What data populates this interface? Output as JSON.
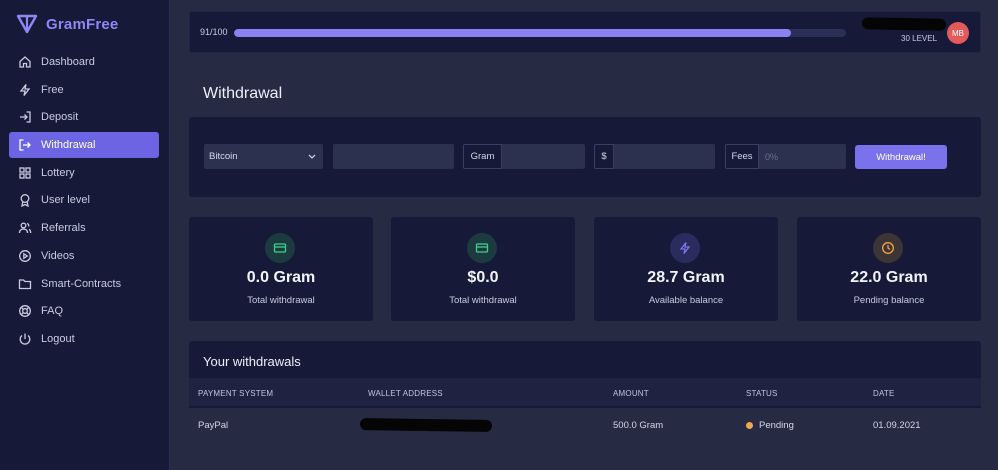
{
  "brand": {
    "name": "GramFree",
    "accent": "#8f87f5"
  },
  "sidebar": {
    "items": [
      {
        "label": "Dashboard",
        "icon": "home-icon"
      },
      {
        "label": "Free",
        "icon": "lightning-icon"
      },
      {
        "label": "Deposit",
        "icon": "login-icon"
      },
      {
        "label": "Withdrawal",
        "icon": "logout-arrow-icon",
        "active": true
      },
      {
        "label": "Lottery",
        "icon": "grid-icon"
      },
      {
        "label": "User level",
        "icon": "award-icon"
      },
      {
        "label": "Referrals",
        "icon": "users-icon"
      },
      {
        "label": "Videos",
        "icon": "play-circle-icon"
      },
      {
        "label": "Smart-Contracts",
        "icon": "folder-icon"
      },
      {
        "label": "FAQ",
        "icon": "lifebuoy-icon"
      },
      {
        "label": "Logout",
        "icon": "power-icon"
      }
    ]
  },
  "topbar": {
    "progress_text": "91/100",
    "progress_value": 0.91,
    "level_text": "30 LEVEL",
    "avatar_initials": "MB",
    "avatar_color": "#e35a5a"
  },
  "page": {
    "title": "Withdrawal"
  },
  "form": {
    "payment_method": "Bitcoin",
    "address_value": "",
    "gram_prefix": "Gram",
    "gram_value": "",
    "dollar_prefix": "$",
    "dollar_value": "",
    "fees_prefix": "Fees",
    "fees_placeholder": "0%",
    "submit_label": "Withdrawal!"
  },
  "stats": [
    {
      "value": "0.0 Gram",
      "label": "Total withdrawal",
      "icon": "card-icon",
      "color": "#3ecf8e"
    },
    {
      "value": "$0.0",
      "label": "Total withdrawal",
      "icon": "card-icon",
      "color": "#3ecf8e"
    },
    {
      "value": "28.7 Gram",
      "label": "Available balance",
      "icon": "lightning-icon",
      "color": "#7d74f0"
    },
    {
      "value": "22.0 Gram",
      "label": "Pending balance",
      "icon": "clock-icon",
      "color": "#f0a74a"
    }
  ],
  "withdrawals": {
    "title": "Your withdrawals",
    "columns": [
      "PAYMENT SYSTEM",
      "WALLET ADDRESS",
      "AMOUNT",
      "STATUS",
      "DATE"
    ],
    "rows": [
      {
        "payment_system": "PayPal",
        "wallet_address": "",
        "amount": "500.0 Gram",
        "status": "Pending",
        "date": "01.09.2021"
      }
    ]
  }
}
